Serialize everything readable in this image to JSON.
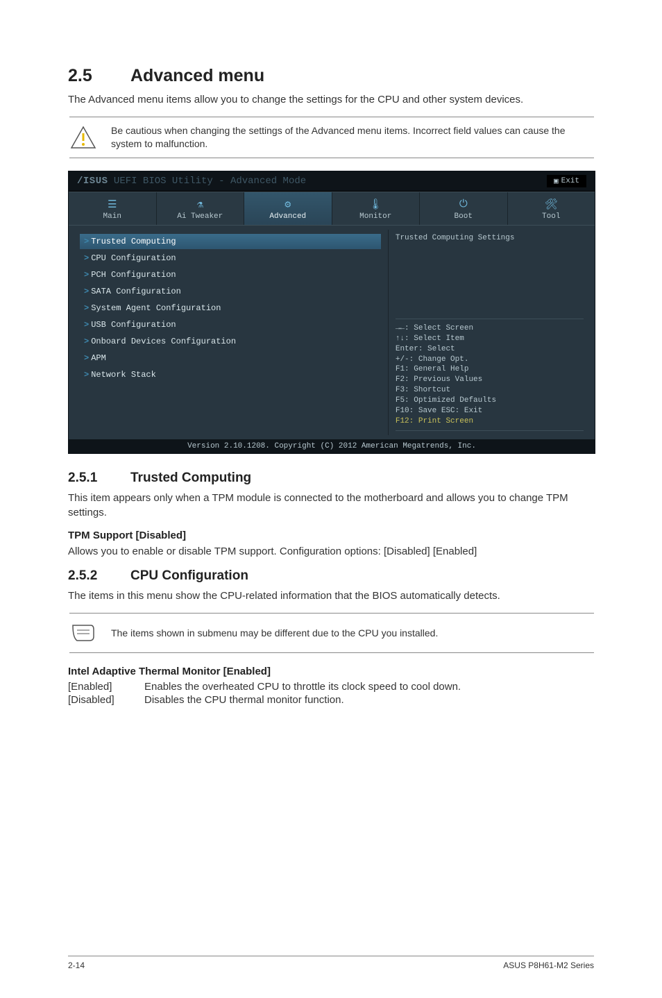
{
  "section": {
    "number": "2.5",
    "title": "Advanced menu"
  },
  "section_desc": "The Advanced menu items allow you to change the settings for the CPU and other system devices.",
  "warning_note": "Be cautious when changing the settings of the Advanced menu items. Incorrect field values can cause the system to malfunction.",
  "bios": {
    "brand": "/ISUS",
    "title": "UEFI BIOS Utility - Advanced Mode",
    "exit_label": "Exit",
    "tabs": [
      {
        "label": "Main",
        "icon": "☰"
      },
      {
        "label": "Ai Tweaker",
        "icon": "⚗"
      },
      {
        "label": "Advanced",
        "icon": "⚙"
      },
      {
        "label": "Monitor",
        "icon": "🌡"
      },
      {
        "label": "Boot",
        "icon": "⏻"
      },
      {
        "label": "Tool",
        "icon": "🛠"
      }
    ],
    "menu": [
      "Trusted Computing",
      "CPU Configuration",
      "PCH Configuration",
      "SATA Configuration",
      "System Agent Configuration",
      "USB Configuration",
      "Onboard Devices Configuration",
      "APM",
      "Network Stack"
    ],
    "right_panel_title": "Trusted Computing Settings",
    "help": [
      "→←: Select Screen",
      "↑↓: Select Item",
      "Enter: Select",
      "+/-: Change Opt.",
      "F1: General Help",
      "F2: Previous Values",
      "F3: Shortcut",
      "F5: Optimized Defaults",
      "F10: Save  ESC: Exit",
      "F12: Print Screen"
    ],
    "footer": "Version 2.10.1208. Copyright (C) 2012 American Megatrends, Inc."
  },
  "sub1": {
    "number": "2.5.1",
    "title": "Trusted Computing",
    "desc": "This item appears only when a TPM module is connected to the motherboard and allows you to change TPM settings.",
    "setting_title": "TPM Support [Disabled]",
    "setting_desc": "Allows you to enable or disable TPM support. Configuration options: [Disabled] [Enabled]"
  },
  "sub2": {
    "number": "2.5.2",
    "title": "CPU Configuration",
    "desc": "The items in this menu show the CPU-related information that the BIOS automatically detects.",
    "note": "The items shown in submenu may be different due to the CPU you installed.",
    "setting_title": "Intel Adaptive Thermal Monitor [Enabled]",
    "opts": [
      {
        "k": "[Enabled]",
        "v": "Enables the overheated CPU to throttle its clock speed to cool down."
      },
      {
        "k": "[Disabled]",
        "v": "Disables the CPU thermal monitor function."
      }
    ]
  },
  "footer": {
    "page": "2-14",
    "product": "ASUS P8H61-M2 Series"
  }
}
